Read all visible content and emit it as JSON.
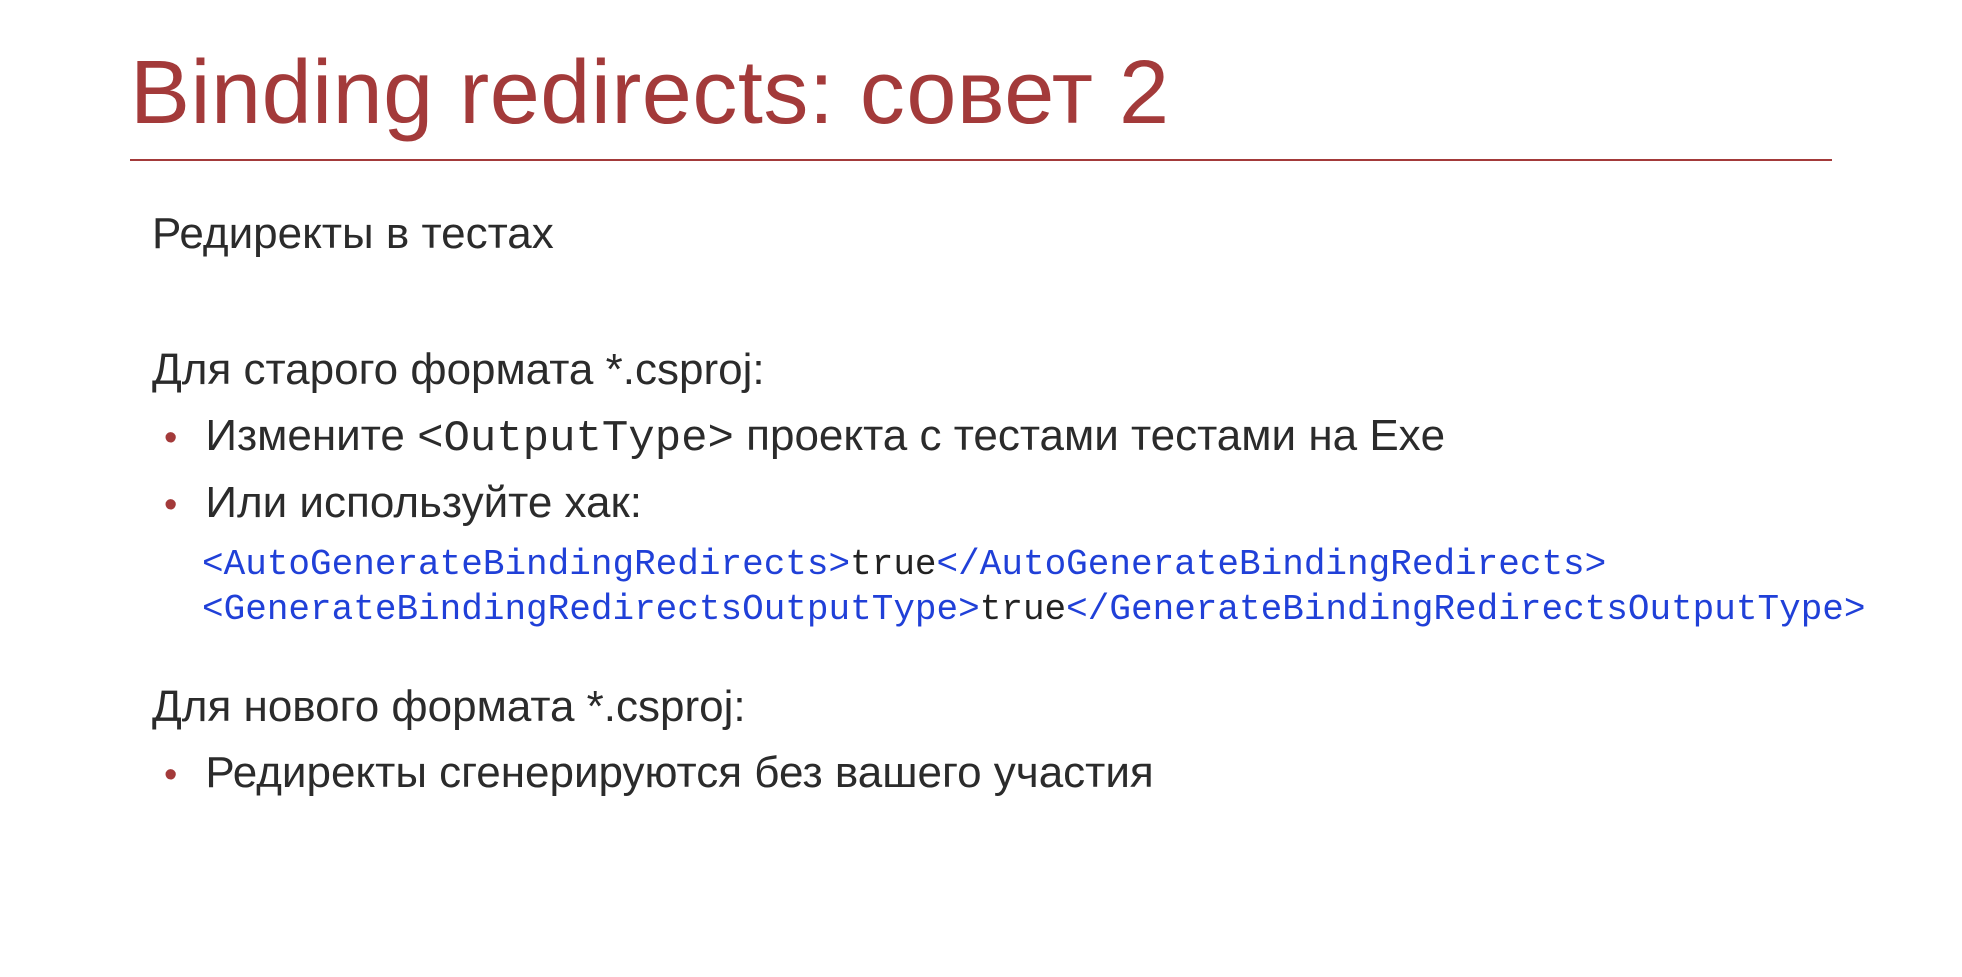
{
  "title": "Binding redirects: совет 2",
  "subtitle": "Редиректы в тестах",
  "section_old": "Для старого формата *.csproj:",
  "bullet1_pre": "Измените ",
  "bullet1_code": "<OutputType>",
  "bullet1_post": " проекта с тестами тестами на Exe",
  "bullet2": "Или используйте хак:",
  "code": {
    "line1_open": "<",
    "line1_tag": "AutoGenerateBindingRedirects",
    "line1_mid": ">",
    "line1_val": "true",
    "line1_close_open": "</",
    "line1_close_tag": "AutoGenerateBindingRedirects",
    "line1_close": ">",
    "line2_open": "<",
    "line2_tag": "GenerateBindingRedirectsOutputType",
    "line2_mid": ">",
    "line2_val": "true",
    "line2_close_open": "</",
    "line2_close_tag": "GenerateBindingRedirectsOutputType",
    "line2_close": ">"
  },
  "section_new": "Для нового формата *.csproj:",
  "bullet3": "Редиректы сгенерируются без вашего участия"
}
